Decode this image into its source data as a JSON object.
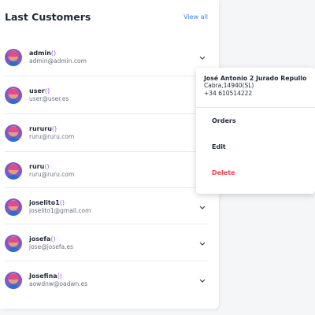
{
  "card": {
    "title": "Last Customers",
    "view_all": "View all"
  },
  "customers": [
    {
      "name": "admin",
      "suffix": "()",
      "email": "admin@admin.com"
    },
    {
      "name": "user",
      "suffix": "()",
      "email": "user@user.es"
    },
    {
      "name": "rururu",
      "suffix": "()",
      "email": "ruru@ruru.com"
    },
    {
      "name": "ruru",
      "suffix": "()",
      "email": "ruru@ruru.com"
    },
    {
      "name": "joselito1",
      "suffix": "()",
      "email": "joselito1@gmail.com"
    },
    {
      "name": "josefa",
      "suffix": "()",
      "email": "jose@josefa.es"
    },
    {
      "name": "Josefina",
      "suffix": "()",
      "email": "aowdnw@oadwn.es"
    }
  ],
  "popup": {
    "name": "José Antonio 2 Jurado Repullo",
    "address": "Cabra,14940(SL)",
    "phone": "+34 610514222",
    "menu": {
      "orders": "Orders",
      "edit": "Edit",
      "delete": "Delete"
    }
  },
  "icons": {
    "avatar": "avatar-icon",
    "chevron": "chevron-down-icon"
  },
  "colors": {
    "link": "#3b82f6",
    "name_suffix": "#a855f7",
    "delete": "#ef4444"
  }
}
